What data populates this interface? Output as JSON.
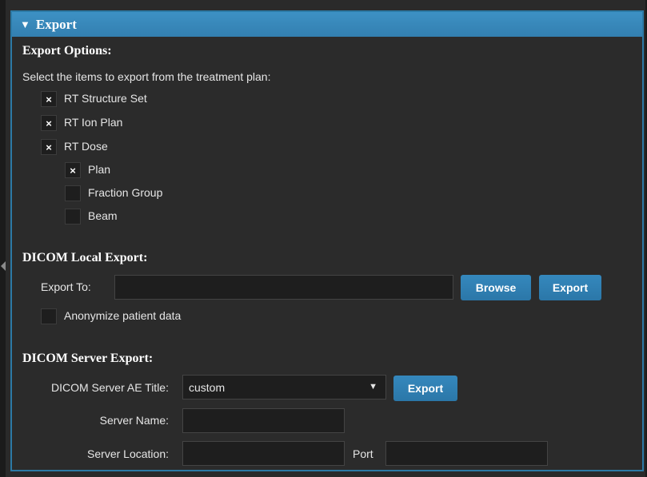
{
  "panel": {
    "title": "Export",
    "collapse_icon": "triangle-down"
  },
  "export_options": {
    "heading": "Export Options:",
    "instructions": "Select the items to export from the treatment plan:",
    "items": [
      {
        "label": "RT Structure Set",
        "checked": true
      },
      {
        "label": "RT Ion Plan",
        "checked": true
      },
      {
        "label": "RT Dose",
        "checked": true
      },
      {
        "label": "Plan",
        "checked": true
      },
      {
        "label": "Fraction Group",
        "checked": false
      },
      {
        "label": "Beam",
        "checked": false
      }
    ],
    "check_mark": "×"
  },
  "local_export": {
    "heading": "DICOM Local Export:",
    "export_to_label": "Export To:",
    "export_to_value": "",
    "browse_label": "Browse",
    "export_label": "Export",
    "anonymize_label": "Anonymize patient data",
    "anonymize_checked": false
  },
  "server_export": {
    "heading": "DICOM Server Export:",
    "ae_title_label": "DICOM Server AE Title:",
    "ae_title_value": "custom",
    "ae_title_arrow": "▼",
    "export_label": "Export",
    "server_name_label": "Server Name:",
    "server_name_value": "",
    "server_location_label": "Server Location:",
    "server_location_value": "",
    "port_label": "Port",
    "port_value": ""
  },
  "colors": {
    "accent": "#3a8cbf",
    "background": "#2b2b2b",
    "input_background": "#1e1e1e"
  }
}
